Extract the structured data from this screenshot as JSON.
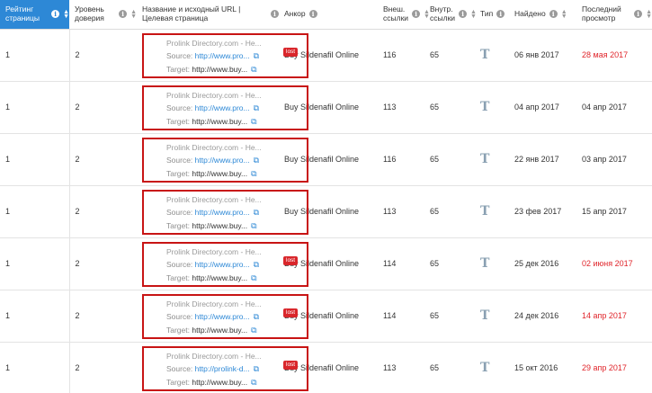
{
  "columns": [
    {
      "label": "Рейтинг страницы",
      "info": "i",
      "sort": "▲▼"
    },
    {
      "label": "Уровень доверия",
      "info": "i",
      "sort": "▲▼"
    },
    {
      "label": "Название и исходный URL | Целевая страница",
      "info": "i"
    },
    {
      "label": "Анкор",
      "info": "i"
    },
    {
      "label": "Внеш. ссылки",
      "info": "i",
      "sort": "▲▼"
    },
    {
      "label": "Внутр. ссылки",
      "info": "i",
      "sort": "▲▼"
    },
    {
      "label": "Тип",
      "info": "i"
    },
    {
      "label": "Найдено",
      "info": "i",
      "sort": "▲▼"
    },
    {
      "label": "Последний просмотр",
      "info": "i",
      "sort": "▲▼"
    }
  ],
  "source_label": "Source:",
  "target_label": "Target:",
  "lost_label": "lost",
  "type_glyph": "T",
  "rows": [
    {
      "rank": "1",
      "trust": "2",
      "title": "Prolink Directory.com - He...",
      "source": "http://www.pro...",
      "target": "http://www.buy...",
      "lost": true,
      "anchor": "Buy Sildenafil Online",
      "ext": "116",
      "int": "65",
      "found": "06 янв 2017",
      "last": "28 мая 2017",
      "last_red": true
    },
    {
      "rank": "1",
      "trust": "2",
      "title": "Prolink Directory.com - He...",
      "source": "http://www.pro...",
      "target": "http://www.buy...",
      "lost": false,
      "anchor": "Buy Sildenafil Online",
      "ext": "113",
      "int": "65",
      "found": "04 апр 2017",
      "last": "04 апр 2017",
      "last_red": false
    },
    {
      "rank": "1",
      "trust": "2",
      "title": "Prolink Directory.com - He...",
      "source": "http://www.pro...",
      "target": "http://www.buy...",
      "lost": false,
      "anchor": "Buy Sildenafil Online",
      "ext": "116",
      "int": "65",
      "found": "22 янв 2017",
      "last": "03 апр 2017",
      "last_red": false
    },
    {
      "rank": "1",
      "trust": "2",
      "title": "Prolink Directory.com - He...",
      "source": "http://www.pro...",
      "target": "http://www.buy...",
      "lost": false,
      "anchor": "Buy Sildenafil Online",
      "ext": "113",
      "int": "65",
      "found": "23 фев 2017",
      "last": "15 апр 2017",
      "last_red": false
    },
    {
      "rank": "1",
      "trust": "2",
      "title": "Prolink Directory.com - He...",
      "source": "http://www.pro...",
      "target": "http://www.buy...",
      "lost": true,
      "anchor": "Buy Sildenafil Online",
      "ext": "114",
      "int": "65",
      "found": "25 дек 2016",
      "last": "02 июня 2017",
      "last_red": true
    },
    {
      "rank": "1",
      "trust": "2",
      "title": "Prolink Directory.com - He...",
      "source": "http://www.pro...",
      "target": "http://www.buy...",
      "lost": true,
      "anchor": "Buy Sildenafil Online",
      "ext": "114",
      "int": "65",
      "found": "24 дек 2016",
      "last": "14 апр 2017",
      "last_red": true
    },
    {
      "rank": "1",
      "trust": "2",
      "title": "Prolink Directory.com - He...",
      "source": "http://prolink-d...",
      "target": "http://www.buy...",
      "lost": true,
      "anchor": "Buy Sildenafil Online",
      "ext": "113",
      "int": "65",
      "found": "15 окт 2016",
      "last": "29 апр 2017",
      "last_red": true
    }
  ]
}
